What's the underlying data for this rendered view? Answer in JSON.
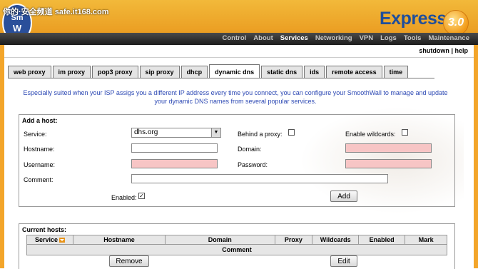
{
  "watermark": "你的·安全频道 safe.it168.com",
  "brand": {
    "logo_text": "Smooth Wall",
    "product": "Express",
    "version": "3.0"
  },
  "nav": {
    "items": [
      "Control",
      "About",
      "Services",
      "Networking",
      "VPN",
      "Logs",
      "Tools",
      "Maintenance"
    ],
    "active": "Services"
  },
  "topbar": {
    "shutdown": "shutdown",
    "separator": "|",
    "help": "help"
  },
  "tabs": [
    "web proxy",
    "im proxy",
    "pop3 proxy",
    "sip proxy",
    "dhcp",
    "dynamic dns",
    "static dns",
    "ids",
    "remote access",
    "time"
  ],
  "active_tab": "dynamic dns",
  "intro": {
    "line1": "Especially suited when your ISP assigs you a different IP address every time you connect, you can configure your SmoothWall to manage and update",
    "line2": "your dynamic DNS names from several popular services."
  },
  "add_host": {
    "title": "Add a host:",
    "service_label": "Service:",
    "service_value": "dhs.org",
    "behind_proxy_label": "Behind a proxy:",
    "enable_wildcards_label": "Enable wildcards:",
    "hostname_label": "Hostname:",
    "domain_label": "Domain:",
    "username_label": "Username:",
    "password_label": "Password:",
    "comment_label": "Comment:",
    "enabled_label": "Enabled:",
    "enabled_checked": true,
    "add_button": "Add"
  },
  "current_hosts": {
    "title": "Current hosts:",
    "columns": [
      "Service",
      "Hostname",
      "Domain",
      "Proxy",
      "Wildcards",
      "Enabled",
      "Mark"
    ],
    "subheader": "Comment",
    "remove_button": "Remove",
    "edit_button": "Edit"
  },
  "colors": {
    "header_orange": "#e8941a",
    "link_blue": "#2d49b4",
    "required_pink": "#f7c5c5",
    "brand_blue": "#1f4e9c"
  }
}
